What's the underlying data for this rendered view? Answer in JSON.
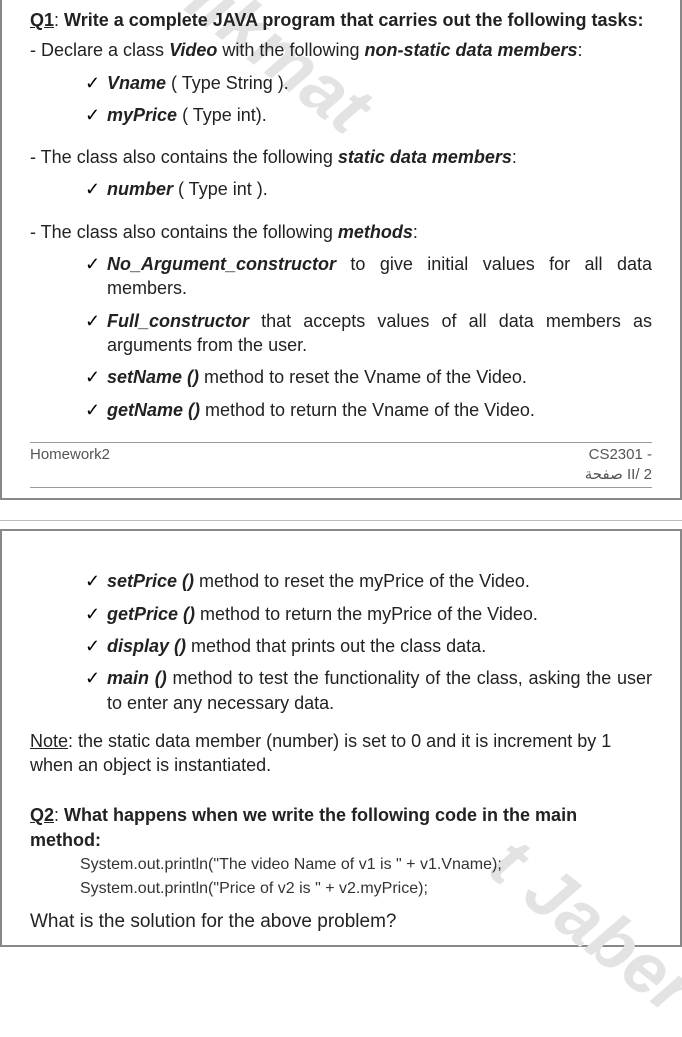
{
  "p1": {
    "q1_label": "Q1",
    "q1_text": "Write a complete JAVA program that carries out the following tasks:",
    "d1_a": "Declare a class ",
    "d1_video": "Video",
    "d1_b": " with the following ",
    "d1_nsdm": "non-static data members",
    "d1_c": ":",
    "vname": "Vname",
    "vname_type": "  ( Type  String ).",
    "myprice": "myPrice",
    "myprice_type": "   ( Type  int).",
    "d2_a": "The class also contains the following ",
    "d2_sdm": "static data members",
    "d2_b": ":",
    "number": "number",
    "number_type": "  ( Type int ).",
    "d3_a": "The class also contains the following ",
    "d3_methods": "methods",
    "d3_b": ":",
    "noarg": "No_Argument_constructor",
    "noarg_txt": " to give initial values for all data members.",
    "full": "Full_constructor",
    "full_txt": " that accepts values of all data members as arguments from the user.",
    "setname": "setName ()",
    "setname_txt": " method to reset the Vname of the Video.",
    "getname": "getName ()",
    "getname_txt": " method to return the Vname of the Video.",
    "footer_left": "Homework2",
    "footer_r1": "CS2301 -",
    "footer_r2": "صفحة II/ 2"
  },
  "p2": {
    "setprice": "setPrice ()",
    "setprice_txt": " method to reset the myPrice of the Video.",
    "getprice": "getPrice ()",
    "getprice_txt": " method to return the myPrice of the Video.",
    "display": "display ()",
    "display_txt": " method that prints out the class data.",
    "main": "main ()",
    "main_txt": " method to test the functionality of the class, asking the user to enter any necessary data.",
    "note_label": "Note",
    "note_txt": ": the static data member (number) is set to 0 and it is increment by 1 when an object is instantiated.",
    "q2_label": "Q2",
    "q2_text": "What happens when we write the following code in the main method:",
    "code1": "System.out.println(\"The video Name of v1 is \" + v1.Vname);",
    "code2": "System.out.println(\"Price of v2 is \" + v2.myPrice);",
    "solution": "What is the solution for the above problem?"
  },
  "wm1": "Dr. Hikmat",
  "wm2": "  t Jaber"
}
